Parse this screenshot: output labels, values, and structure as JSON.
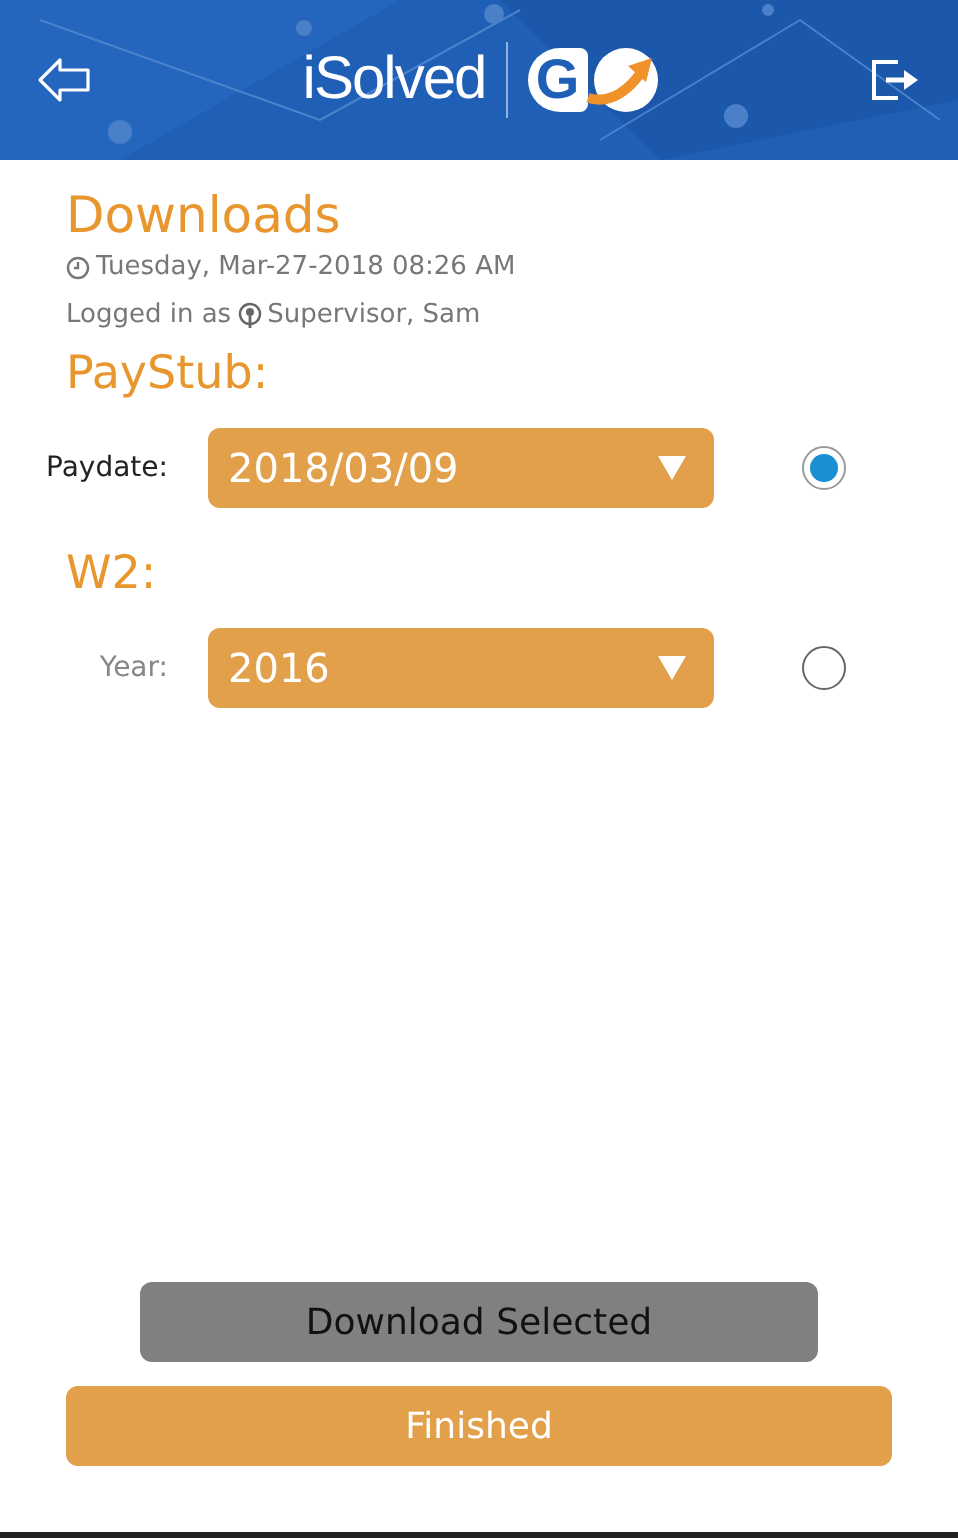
{
  "header": {
    "logo_text": "iSolved",
    "logo_mark": "G"
  },
  "title": "Downloads",
  "timestamp": "Tuesday, Mar-27-2018 08:26 AM",
  "logged_in": {
    "label": "Logged in as",
    "user": "Supervisor, Sam"
  },
  "sections": [
    {
      "heading": "PayStub:",
      "label": "Paydate:",
      "value": "2018/03/09",
      "selected": true
    },
    {
      "heading": "W2:",
      "label": "Year:",
      "value": "2016",
      "selected": false
    }
  ],
  "buttons": [
    {
      "label": "Download Selected",
      "kind": "secondary"
    },
    {
      "label": "Finished",
      "kind": "primary"
    }
  ]
}
